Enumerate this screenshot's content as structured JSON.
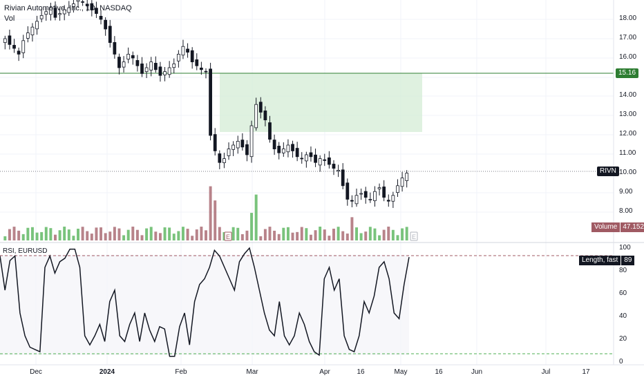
{
  "header": {
    "title": "Rivian Automotive, Inc., 1D, NASDAQ",
    "vol_label": "Vol"
  },
  "price_axis": {
    "ticks": [
      "18.00",
      "17.00",
      "16.00",
      "15.00",
      "14.00",
      "13.00",
      "12.00",
      "11.00",
      "10.00",
      "9.00",
      "8.00"
    ]
  },
  "levels": {
    "resistance": "15.16",
    "ticker": "RIVN",
    "volume_label": "Volume",
    "volume_value": "47.152M"
  },
  "rsi": {
    "label": "RSI, EURUSD",
    "length_label": "Length, fast",
    "value": "89",
    "ticks": [
      "100",
      "80",
      "60",
      "40",
      "20",
      "0"
    ],
    "upper": 92,
    "lower": 7
  },
  "time_axis": {
    "labels": [
      "Dec",
      "2024",
      "Feb",
      "Mar",
      "Apr",
      "16",
      "May",
      "16",
      "Jun",
      "Jul",
      "17"
    ]
  },
  "markers": {
    "earnings": "E"
  },
  "colors": {
    "up": "#26a69a",
    "down": "#131722",
    "vol_up": "#4caf50",
    "vol_down": "#a05a63",
    "zone": "#d4ecd6",
    "line": "#2e7d32"
  },
  "chart_data": {
    "type": "candlestick",
    "title": "Rivian Automotive, Inc., 1D, NASDAQ",
    "ylim": [
      7.5,
      19.0
    ],
    "resistance": 15.16,
    "last_price": 10.05,
    "sample_close": [
      17.0,
      16.7,
      16.5,
      16.2,
      16.9,
      17.3,
      17.6,
      17.9,
      18.2,
      18.4,
      18.6,
      18.1,
      18.3,
      18.5,
      18.6,
      18.8,
      19.0,
      18.9,
      18.7,
      18.5,
      18.3,
      18.0,
      17.5,
      16.8,
      16.2,
      15.5,
      15.8,
      16.2,
      16.0,
      15.6,
      15.2,
      15.5,
      15.8,
      15.4,
      15.1,
      15.3,
      15.5,
      15.7,
      16.2,
      16.6,
      16.3,
      15.8,
      15.6,
      15.4,
      15.3,
      12.0,
      11.2,
      10.6,
      10.8,
      11.3,
      11.5,
      11.7,
      11.4,
      11.0,
      12.5,
      13.6,
      13.2,
      12.8,
      11.8,
      11.3,
      11.1,
      11.3,
      11.5,
      11.2,
      10.9,
      10.8,
      11.0,
      10.9,
      10.6,
      10.8,
      10.7,
      10.5,
      10.3,
      10.2,
      9.4,
      8.7,
      8.6,
      8.9,
      9.0,
      8.8,
      8.7,
      9.1,
      9.3,
      8.8,
      8.6,
      8.9,
      9.4,
      9.8,
      10.05
    ],
    "rsi_values": [
      90,
      60,
      86,
      90,
      40,
      20,
      10,
      8,
      6,
      80,
      90,
      75,
      85,
      88,
      96,
      96,
      80,
      20,
      12,
      20,
      30,
      15,
      50,
      60,
      20,
      15,
      30,
      40,
      15,
      40,
      25,
      15,
      28,
      26,
      2,
      2,
      28,
      40,
      12,
      50,
      65,
      70,
      80,
      95,
      90,
      80,
      70,
      60,
      85,
      92,
      97,
      80,
      60,
      40,
      25,
      20,
      50,
      20,
      12,
      20,
      40,
      30,
      15,
      6,
      3,
      70,
      80,
      60,
      70,
      20,
      8,
      6,
      20,
      50,
      40,
      55,
      80,
      85,
      70,
      40,
      35,
      65,
      89
    ]
  }
}
